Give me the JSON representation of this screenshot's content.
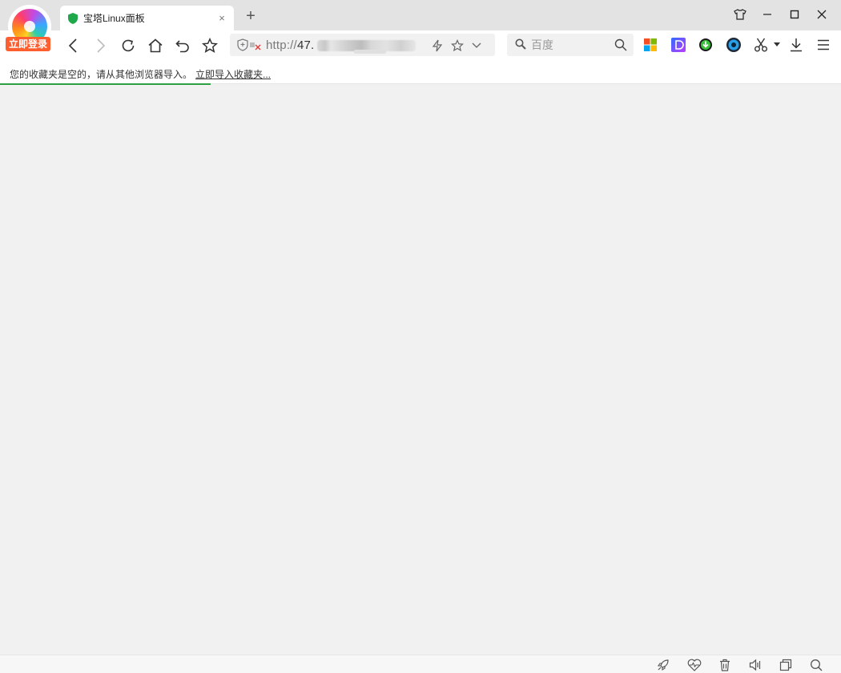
{
  "account": {
    "login_label": "立即登录"
  },
  "tab": {
    "title": "宝塔Linux面板",
    "close_glyph": "×"
  },
  "new_tab_glyph": "+",
  "address": {
    "protocol": "http://",
    "host_visible": "47."
  },
  "search": {
    "provider": "百度"
  },
  "bookmarks_bar": {
    "message": "您的收藏夹是空的，请从其他浏览器导入。",
    "import_link": "立即导入收藏夹..."
  },
  "page_load_progress": 0.25,
  "colors": {
    "login_badge": "#ff5f2e",
    "progress": "#2ea043",
    "tab_icon": "#1fa84a"
  },
  "icons": {
    "window": [
      "skin-icon",
      "minimize-icon",
      "maximize-icon",
      "close-icon"
    ],
    "nav": [
      "back-icon",
      "forward-icon",
      "reload-icon",
      "home-icon",
      "undo-close-tab-icon",
      "favorite-icon"
    ],
    "extensions": [
      "windows-apps-icon",
      "video-ext-icon",
      "download-manager-icon",
      "media-ext-icon",
      "scissors-icon",
      "downloads-icon",
      "menu-icon"
    ],
    "status": [
      "accelerate-icon",
      "health-icon",
      "clean-icon",
      "sound-icon",
      "window-icon",
      "zoom-icon"
    ]
  }
}
